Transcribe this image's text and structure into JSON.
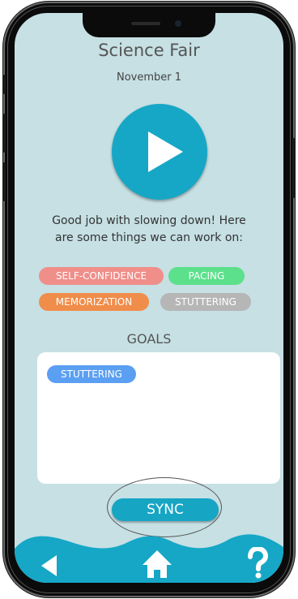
{
  "colors": {
    "screen_bg": "#c6e0e4",
    "accent": "#16a7c6",
    "tag_self_confidence": "#f08e8a",
    "tag_pacing": "#5ce08b",
    "tag_memorization": "#f08d4b",
    "tag_stuttering": "#b6b6b6",
    "goal_tag": "#5b9ff2"
  },
  "header": {
    "title": "Science Fair",
    "date": "November 1"
  },
  "player": {
    "icon": "play-icon"
  },
  "feedback": {
    "message": "Good job with slowing down! Here are some things we can work on:"
  },
  "tags": [
    {
      "label": "SELF-CONFIDENCE"
    },
    {
      "label": "PACING"
    },
    {
      "label": "MEMORIZATION"
    },
    {
      "label": "STUTTERING"
    }
  ],
  "goals": {
    "heading": "GOALS",
    "items": [
      {
        "label": "STUTTERING"
      }
    ]
  },
  "sync": {
    "label": "SYNC"
  },
  "nav": {
    "back_icon": "back-arrow-icon",
    "home_icon": "home-icon",
    "help_icon": "help-icon"
  }
}
